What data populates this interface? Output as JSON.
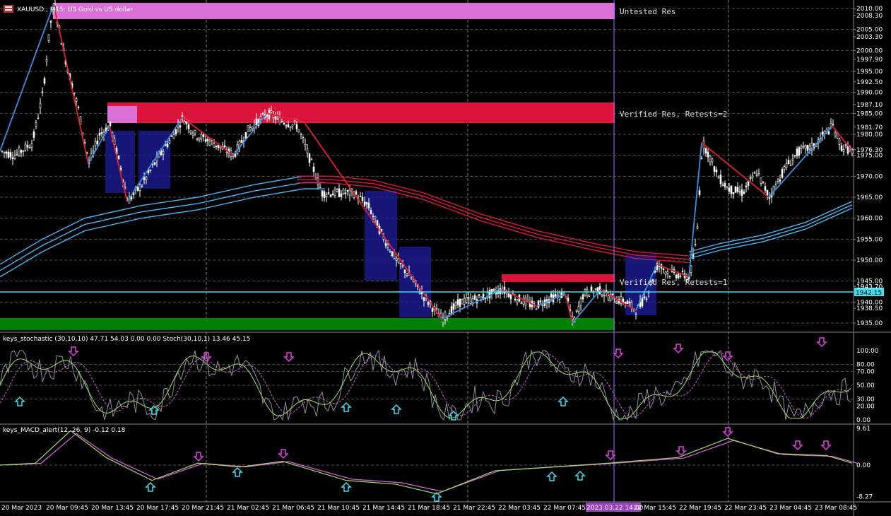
{
  "chart_title": "XAUUSD., M15: US Gold vs US dollar",
  "main_price_scale": [
    "2010.00",
    "2008.30",
    "2005.00",
    "2003.30",
    "2000.00",
    "1997.90",
    "1995.00",
    "1992.50",
    "1990.00",
    "1987.10",
    "1985.00",
    "1981.70",
    "1980.00",
    "1976.30",
    "1975.00",
    "1970.00",
    "1965.00",
    "1960.00",
    "1955.00",
    "1950.00",
    "1945.00",
    "1943.70",
    "1940.00",
    "1938.50",
    "1935.00"
  ],
  "current_price": "1942.15",
  "zones": [
    {
      "label": "Untested Res",
      "color": "#da70d6"
    },
    {
      "label": "Verified Res, Retests=2",
      "color": "#dc143c"
    },
    {
      "label": "Verified Res, Retests=1",
      "color": "#dc143c"
    },
    {
      "label": "",
      "color": "#008000"
    }
  ],
  "stochastic": {
    "label": "keys_stochastic (30,10,10) 47.71 54.03 0.00 0.00 Stoch(30,10,1) 13.46 45.15",
    "scale": [
      "100.00",
      "80.00",
      "70.00",
      "50.00",
      "30.00",
      "20.00",
      "0.00"
    ]
  },
  "macd": {
    "label": "keys_MACD_alert(12, 26, 9) -0.12 0.18",
    "scale": [
      "9.61",
      "0.00",
      "-8.27"
    ]
  },
  "time_axis": [
    "20 Mar 2023",
    "20 Mar 09:45",
    "20 Mar 13:45",
    "20 Mar 17:45",
    "20 Mar 21:45",
    "21 Mar 02:45",
    "21 Mar 06:45",
    "21 Mar 10:45",
    "21 Mar 14:45",
    "21 Mar 18:45",
    "21 Mar 22:45",
    "22 Mar 03:45",
    "22 Mar 07:45",
    "2023.03.22 14:00",
    "22 Mar 15:45",
    "22 Mar 19:45",
    "22 Mar 23:45",
    "23 Mar 04:45",
    "23 Mar 08:45"
  ],
  "crosshair_time": "2023.03.22 14:00",
  "colors": {
    "bull": "#ffffff",
    "bear": "#ffffff",
    "zigzag_up": "#3b8fe0",
    "zigzag_down": "#e0202a",
    "ma_red": "#dc143c",
    "ma_blue": "#46b4f0",
    "signal_up": "#40e0f0",
    "signal_down": "#e040e0"
  },
  "chart_type": "candlestick",
  "grid": true
}
